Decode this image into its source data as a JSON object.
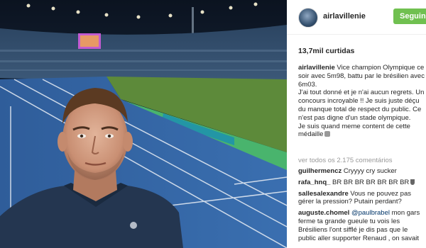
{
  "post": {
    "username": "airlavillenie",
    "follow_label": "Seguindo",
    "likes": "13,7mil curtidas",
    "caption": {
      "username": "airlavillenie",
      "lines": [
        " Vice champion Olympique ce soir avec 5m98, battu par le brésilien avec 6m03.",
        "J'ai tout donné et je n'ai aucun regrets. Un concours incroyable !! Je suis juste déçu du manque total de respect du public. Ce n'est pas digne d'un stade olympique.",
        "Je suis quand meme content de cette médaille"
      ]
    },
    "view_all_comments": "ver todos os 2.175 comentários",
    "comments": [
      {
        "username": "guilhermencz",
        "text": " Cryyyy cry sucker"
      },
      {
        "username": "rafa_hnq_",
        "text": " BR BR BR BR BR BR BR"
      },
      {
        "username": "sallesalexandre",
        "text": " Vous ne pouvez pas gérer la pression? Putain perdant?"
      },
      {
        "username": "auguste.chomel",
        "mention": " @paulbrabel",
        "text": " mon gars ferme ta grande gueule tu vois les Brésiliens l'ont sifflé je dis pas que le public aller supporter Renaud , on savait"
      }
    ]
  },
  "icons": {
    "avatar": "profile-photo",
    "caption_emoji": "emoji-icon",
    "trophy": "trophy-icon"
  },
  "colors": {
    "follow_button": "#70c050",
    "text": "#262626",
    "muted": "#999999",
    "mention": "#003569"
  }
}
